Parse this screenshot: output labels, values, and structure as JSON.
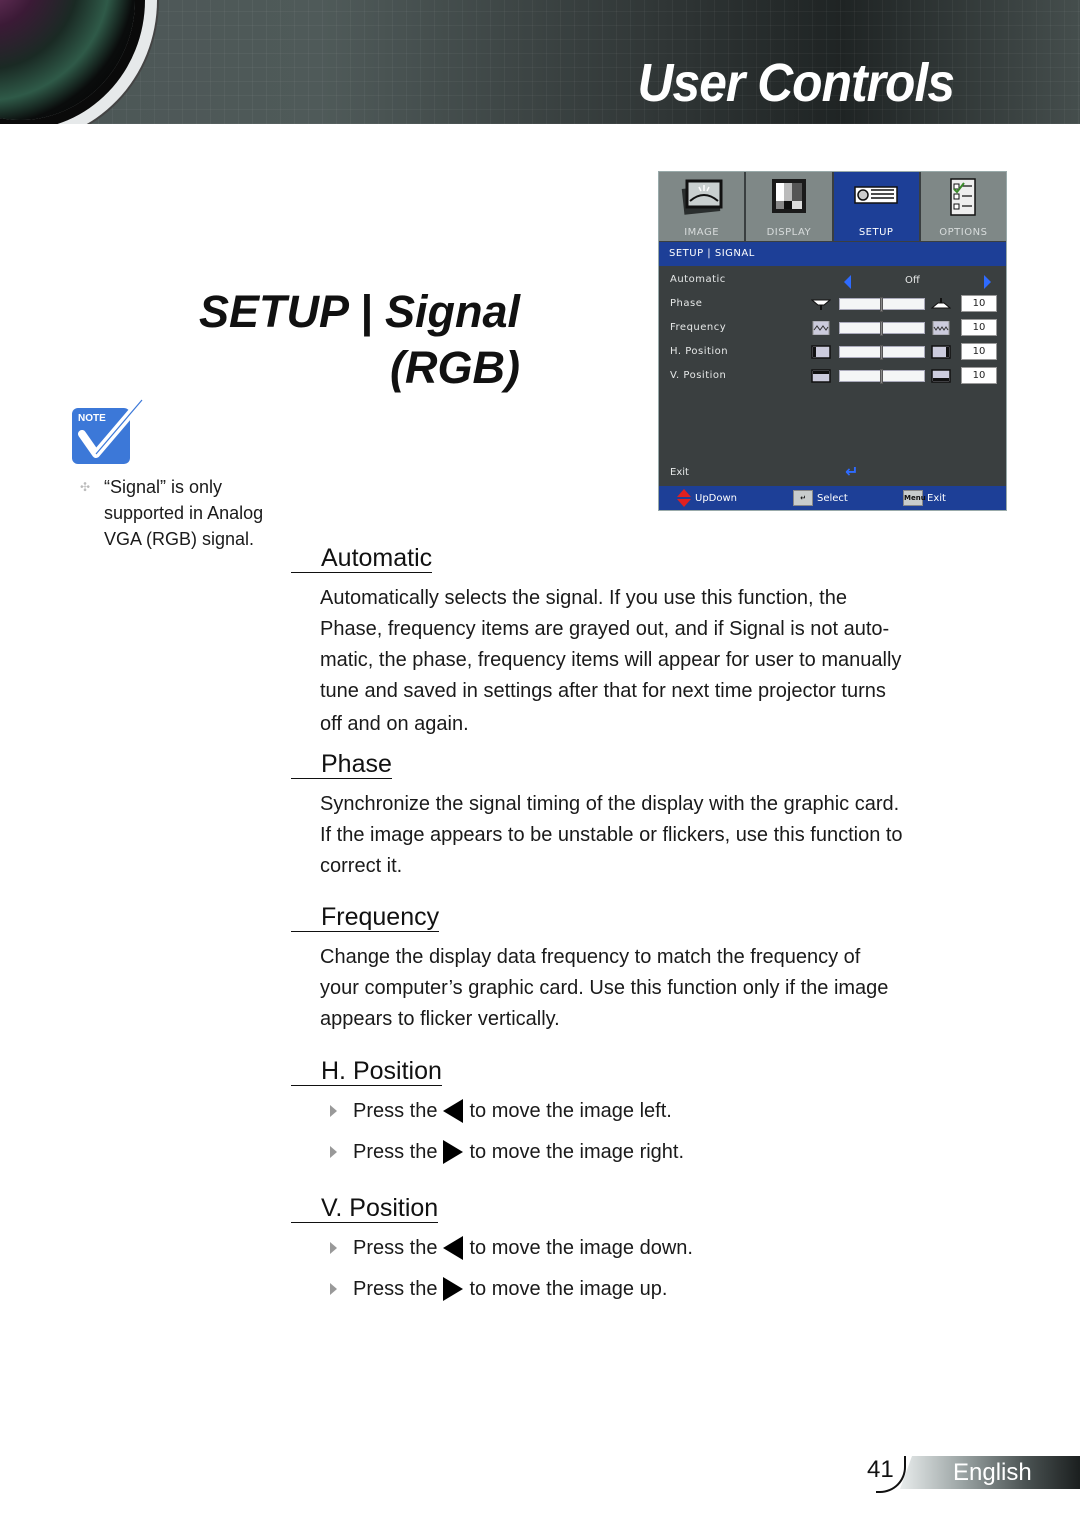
{
  "header": {
    "title": "User Controls"
  },
  "page_title": {
    "line1": "SETUP | Signal",
    "line2": "(RGB)"
  },
  "note": {
    "badge": "NOTE",
    "lines": [
      "“Signal” is only",
      "supported in Analog",
      "VGA (RGB) signal."
    ]
  },
  "osd": {
    "tabs": [
      {
        "label": "IMAGE",
        "icon": "picture-icon",
        "active": false
      },
      {
        "label": "DISPLAY",
        "icon": "display-pattern-icon",
        "active": false
      },
      {
        "label": "SETUP",
        "icon": "projector-icon",
        "active": true
      },
      {
        "label": "OPTIONS",
        "icon": "checklist-icon",
        "active": false
      }
    ],
    "breadcrumb": "SETUP | SIGNAL",
    "rows": [
      {
        "label": "Automatic",
        "type": "select",
        "value": "Off"
      },
      {
        "label": "Phase",
        "type": "slider",
        "value": "10",
        "fraction": 0.5
      },
      {
        "label": "Frequency",
        "type": "slider",
        "value": "10",
        "fraction": 0.5
      },
      {
        "label": "H. Position",
        "type": "slider",
        "value": "10",
        "fraction": 0.5
      },
      {
        "label": "V. Position",
        "type": "slider",
        "value": "10",
        "fraction": 0.5
      }
    ],
    "exit_label": "Exit",
    "footer": {
      "updown": "UpDown",
      "select": "Select",
      "menu_key": "Menu",
      "exit": "Exit"
    },
    "colors": {
      "accent_blue": "#1d3f97",
      "arrow_blue": "#2e6bff",
      "updown_red": "#e02020"
    }
  },
  "sections": {
    "automatic": {
      "heading": "Automatic",
      "body_lines": [
        "Automatically selects the signal. If you use this function, the",
        "Phase, frequency items are grayed out, and if Signal is not auto-",
        "matic, the phase, frequency items will appear for user to manually",
        "tune and saved in settings after that for next time projector turns",
        "off and on again."
      ]
    },
    "phase": {
      "heading": "Phase",
      "body_lines": [
        "Synchronize the signal timing of the display with the graphic card.",
        "If the image appears to be unstable or flickers, use this function to",
        "correct it."
      ]
    },
    "frequency": {
      "heading": "Frequency",
      "body_lines": [
        "Change the display data frequency to match the frequency of",
        "your computer’s graphic card. Use this function only if the image",
        "appears to flicker vertically."
      ]
    },
    "h_position": {
      "heading": "H. Position",
      "bullets": [
        {
          "prefix": "Press the",
          "key": "left",
          "suffix": "to move the image left."
        },
        {
          "prefix": "Press the",
          "key": "right",
          "suffix": "to move the image right."
        }
      ]
    },
    "v_position": {
      "heading": "V. Position",
      "bullets": [
        {
          "prefix": "Press the",
          "key": "left",
          "suffix": "to move the image down."
        },
        {
          "prefix": "Press the",
          "key": "right",
          "suffix": "to move the image up."
        }
      ]
    }
  },
  "footer": {
    "page_number": "41",
    "language": "English"
  }
}
